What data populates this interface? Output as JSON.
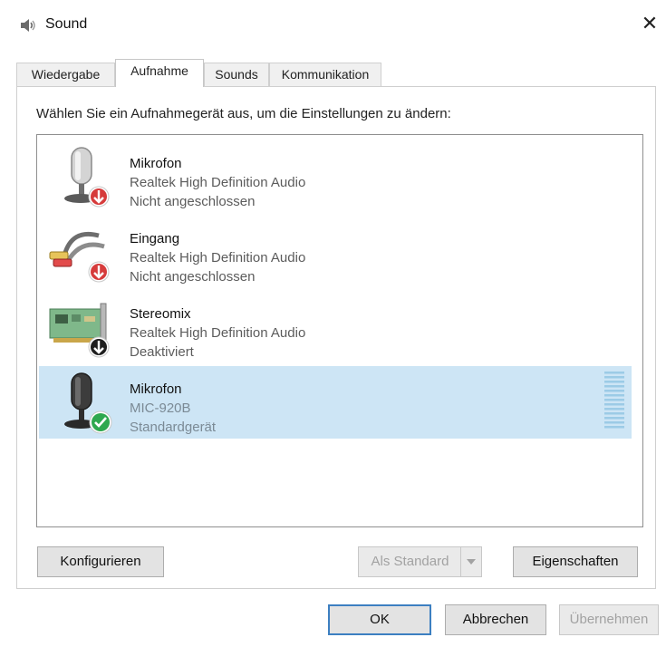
{
  "window": {
    "title": "Sound",
    "close_glyph": "✕"
  },
  "tabs": [
    {
      "label": "Wiedergabe",
      "active": false
    },
    {
      "label": "Aufnahme",
      "active": true
    },
    {
      "label": "Sounds",
      "active": false
    },
    {
      "label": "Kommunikation",
      "active": false
    }
  ],
  "instruction": "Wählen Sie ein Aufnahmegerät aus, um die Einstellungen zu ändern:",
  "devices": [
    {
      "name": "Mikrofon",
      "driver": "Realtek High Definition Audio",
      "status": "Nicht angeschlossen",
      "icon": "microphone-icon",
      "badge": "unplugged-badge-icon"
    },
    {
      "name": "Eingang",
      "driver": "Realtek High Definition Audio",
      "status": "Nicht angeschlossen",
      "icon": "line-in-cable-icon",
      "badge": "unplugged-badge-icon"
    },
    {
      "name": "Stereomix",
      "driver": "Realtek High Definition Audio",
      "status": "Deaktiviert",
      "icon": "sound-card-icon",
      "badge": "disabled-badge-icon"
    },
    {
      "name": "Mikrofon",
      "driver": "MIC-920B",
      "status": "Standardgerät",
      "icon": "microphone-icon",
      "badge": "default-check-badge-icon",
      "selected": true
    }
  ],
  "buttons": {
    "configure": "Konfigurieren",
    "set_default": "Als Standard",
    "properties": "Eigenschaften",
    "ok": "OK",
    "cancel": "Abbrechen",
    "apply": "Übernehmen"
  },
  "colors": {
    "selection": "#cde5f5",
    "focus_border": "#3c7fc1",
    "unplugged_badge": "#d63b3b",
    "default_badge": "#2fa84f"
  }
}
